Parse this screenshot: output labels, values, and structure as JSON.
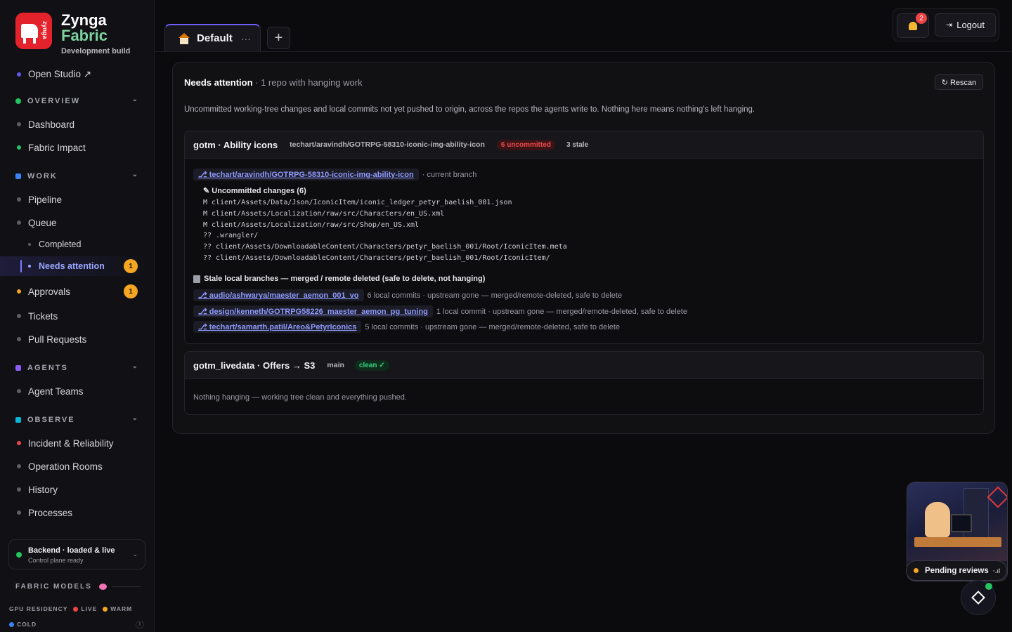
{
  "brand": {
    "line1": "Zynga",
    "line2": "Fabric",
    "subtitle": "Development build",
    "logo_text": "zynga"
  },
  "sidebar": {
    "open_studio": "Open Studio ↗",
    "overview": {
      "label": "OVERVIEW",
      "items": [
        "Dashboard",
        "Fabric Impact"
      ]
    },
    "work": {
      "label": "WORK",
      "items": [
        "Pipeline",
        "Queue"
      ],
      "sub_items": [
        "Completed",
        "Needs attention"
      ],
      "needs_attention_badge": "1",
      "approvals": "Approvals",
      "approvals_badge": "1",
      "more_items": [
        "Tickets",
        "Pull Requests"
      ]
    },
    "agents": {
      "label": "AGENTS",
      "items": [
        "Agent Teams"
      ]
    },
    "observe": {
      "label": "OBSERVE",
      "items": [
        "Incident & Reliability",
        "Operation Rooms",
        "History",
        "Processes"
      ]
    },
    "backend": {
      "title": "Backend · loaded & live",
      "subtitle": "Control plane ready"
    },
    "fabric_models": "FABRIC MODELS",
    "gpu": {
      "label": "GPU RESIDENCY",
      "live": "LIVE",
      "warm": "WARM",
      "cold": "COLD",
      "cold_count": "I"
    }
  },
  "tabs": {
    "default_label": "Default",
    "more": "···",
    "add": "+"
  },
  "header": {
    "notification_count": "2",
    "logout": "Logout"
  },
  "main": {
    "title": "Needs attention",
    "title_suffix": " · 1 repo with hanging work",
    "rescan": "↻ Rescan",
    "description": "Uncommitted working-tree changes and local commits not yet pushed to origin, across the repos the agents write to. Nothing here means nothing's left hanging.",
    "repos": [
      {
        "name": "gotm · Ability icons",
        "branch": "techart/aravindh/GOTRPG-58310-iconic-img-ability-icon",
        "uncommitted_badge": "6 uncommitted",
        "stale_badge": "3 stale",
        "current_branch_link": "⎇ techart/aravindh/GOTRPG-58310-iconic-img-ability-icon",
        "current_branch_note": "· current branch",
        "uncommitted_title": "✎ Uncommitted changes (6)",
        "files": [
          "M client/Assets/Data/Json/IconicItem/iconic_ledger_petyr_baelish_001.json",
          "M client/Assets/Localization/raw/src/Characters/en_US.xml",
          "M client/Assets/Localization/raw/src/Shop/en_US.xml",
          "?? .wrangler/",
          "?? client/Assets/DownloadableContent/Characters/petyr_baelish_001/Root/IconicItem.meta",
          "?? client/Assets/DownloadableContent/Characters/petyr_baelish_001/Root/IconicItem/"
        ],
        "stale_title": "Stale local branches — merged / remote deleted (safe to delete, not hanging)",
        "stale_branches": [
          {
            "name": "⎇ audio/ashwarya/maester_aemon_001_vo",
            "note": "6 local commits · upstream gone — merged/remote-deleted, safe to delete"
          },
          {
            "name": "⎇ design/kenneth/GOTRPG58226_maester_aemon_pg_tuning",
            "note": "1 local commit · upstream gone — merged/remote-deleted, safe to delete"
          },
          {
            "name": "⎇ techart/samarth.patil/Areo&PetyrIconics",
            "note": "5 local commits · upstream gone — merged/remote-deleted, safe to delete"
          }
        ]
      },
      {
        "name": "gotm_livedata · Offers → S3",
        "branch": "main",
        "status": "clean ✓",
        "message": "Nothing hanging — working tree clean and everything pushed."
      }
    ]
  },
  "widget": {
    "pending": "Pending reviews",
    "bars": "·.ıl"
  },
  "colors": {
    "accent": "#6d5cff",
    "badge": "#f5a623",
    "danger": "#ef4444",
    "success": "#22c55e"
  }
}
